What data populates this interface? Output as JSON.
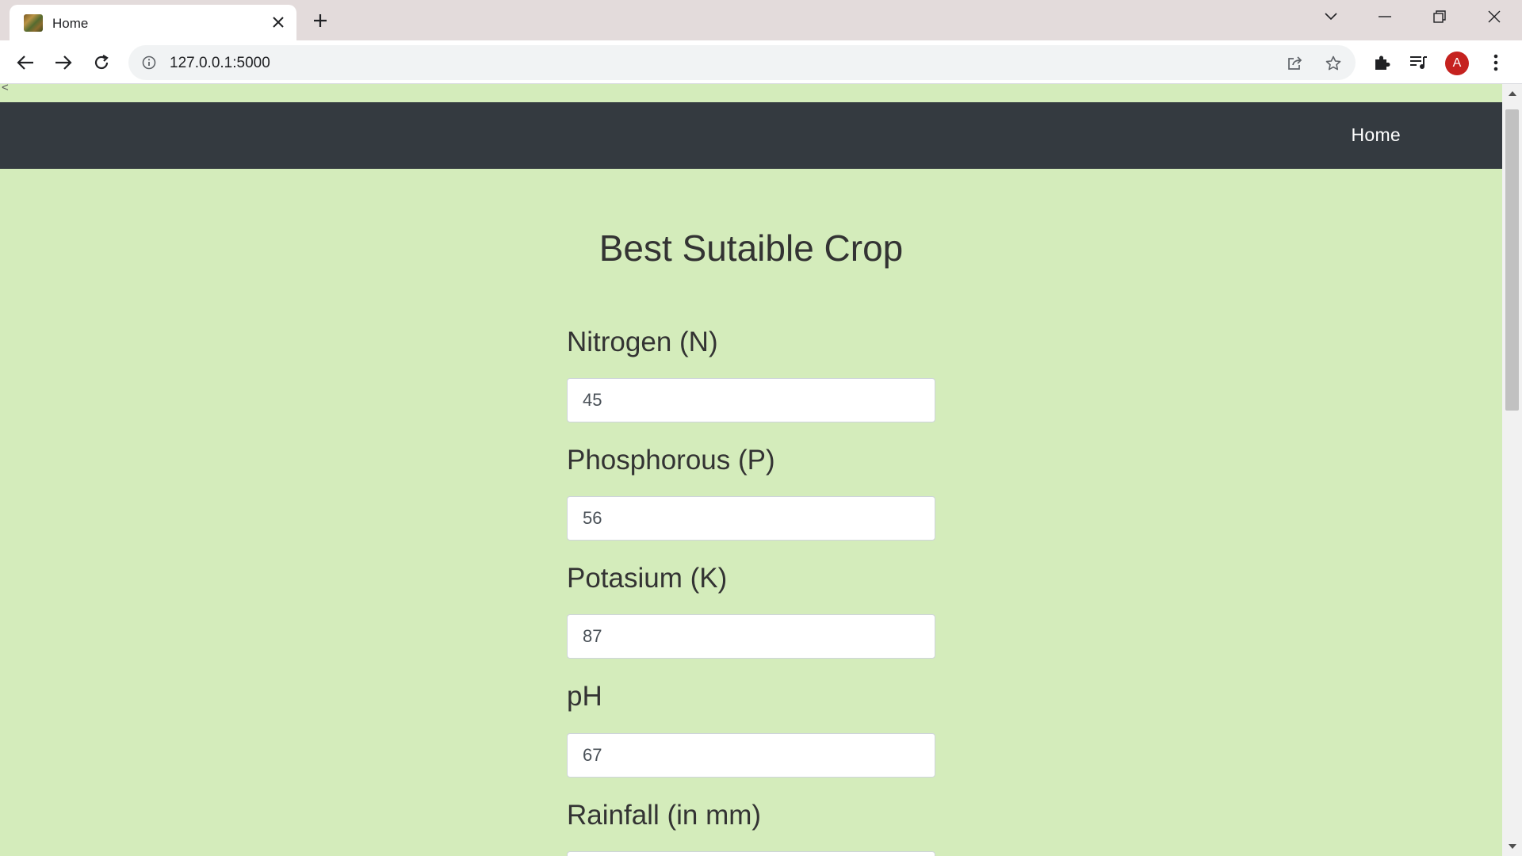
{
  "browser": {
    "tab": {
      "title": "Home",
      "favicon": "crop-field-favicon"
    },
    "address": {
      "url": "127.0.0.1:5000"
    },
    "profile": {
      "initial": "A",
      "color": "#c5221f"
    }
  },
  "page": {
    "stray_text": "<",
    "navbar": {
      "home_label": "Home",
      "background": "#343a40"
    },
    "heading": "Best Sutaible Crop",
    "background": "#d4ecbb",
    "fields": {
      "nitrogen": {
        "label": "Nitrogen (N)",
        "value": "45"
      },
      "phosphorous": {
        "label": "Phosphorous (P)",
        "value": "56"
      },
      "potasium": {
        "label": "Potasium (K)",
        "value": "87"
      },
      "ph": {
        "label": "pH",
        "value": "67"
      },
      "rainfall": {
        "label": "Rainfall (in mm)",
        "value": ""
      }
    }
  }
}
